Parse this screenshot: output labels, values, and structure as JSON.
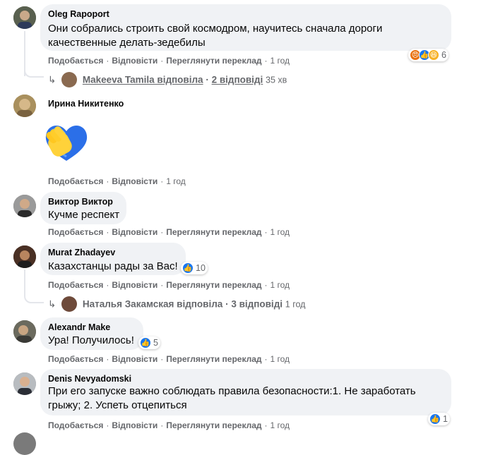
{
  "actions": {
    "like": "Подобається",
    "reply": "Відповісти",
    "translate": "Переглянути переклад",
    "sep": "·"
  },
  "comments": [
    {
      "author": "Oleg Rapoport",
      "lines": [
        "Они собрались строить свой космодром, научитесь сначала дороги",
        "качественные делать-зедебилы"
      ],
      "time": "1 год",
      "reactions": {
        "icons": [
          "angry-reaction-icon",
          "like-reaction-icon",
          "haha-reaction-icon"
        ],
        "count": "6"
      },
      "replies": {
        "who": "Makeeva Tamila відповіла",
        "count": "2 відповіді",
        "time": "35 хв"
      }
    },
    {
      "author": "Ирина Никитенко",
      "sticker": "yellow-blue-heart-hand-sticker",
      "time": "1 год"
    },
    {
      "author": "Виктор Виктор",
      "lines": [
        "Кучме респект"
      ],
      "time": "1 год"
    },
    {
      "author": "Murat Zhadayev",
      "lines": [
        "Казахстанцы рады за Вас!"
      ],
      "time": "1 год",
      "reactions": {
        "icons": [
          "like-reaction-icon"
        ],
        "count": "10"
      },
      "replies": {
        "who": "Наталья Закамская відповіла",
        "count": "3 відповіді",
        "time": "1 год"
      }
    },
    {
      "author": "Alexandr Make",
      "lines": [
        "Ура! Получилось!"
      ],
      "time": "1 год",
      "reactions": {
        "icons": [
          "like-reaction-icon"
        ],
        "count": "5"
      }
    },
    {
      "author": "Denis Nevyadomski",
      "lines": [
        "При его запуске важно соблюдать правила безопасности:1. Не заработать",
        "грыжу; 2. Успеть отцепиться"
      ],
      "time": "1 год",
      "reactions": {
        "icons": [
          "like-reaction-icon"
        ],
        "count": "1"
      }
    }
  ],
  "colors": {
    "bubble": "#f0f2f5",
    "meta": "#65676b",
    "like": "#1877f2",
    "angry": "#e9710f",
    "haha": "#f7b125"
  }
}
